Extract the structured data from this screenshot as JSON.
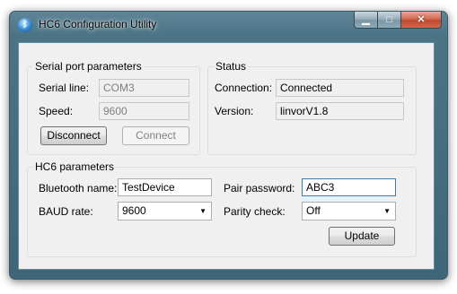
{
  "window": {
    "title": "HC6 Configuration Utility",
    "icon": "bluetooth-icon",
    "caption_buttons": {
      "minimize": "▁",
      "maximize": "□",
      "close": "✕"
    }
  },
  "serial": {
    "title": "Serial port parameters",
    "line_label": "Serial line:",
    "line_value": "COM3",
    "speed_label": "Speed:",
    "speed_value": "9600",
    "disconnect_label": "Disconnect",
    "connect_label": "Connect"
  },
  "status": {
    "title": "Status",
    "connection_label": "Connection:",
    "connection_value": "Connected",
    "version_label": "Version:",
    "version_value": "linvorV1.8"
  },
  "hc6": {
    "title": "HC6 parameters",
    "bt_name_label": "Bluetooth name:",
    "bt_name_value": "TestDevice",
    "pair_password_label": "Pair password:",
    "pair_password_value": "ABC3",
    "baud_label": "BAUD rate:",
    "baud_value": "9600",
    "parity_label": "Parity check:",
    "parity_value": "Off",
    "update_label": "Update"
  },
  "colors": {
    "frame": "#4a7486",
    "client_bg": "#f0f0f0",
    "close_button": "#c04a2f",
    "focus_border": "#3d7bad"
  }
}
